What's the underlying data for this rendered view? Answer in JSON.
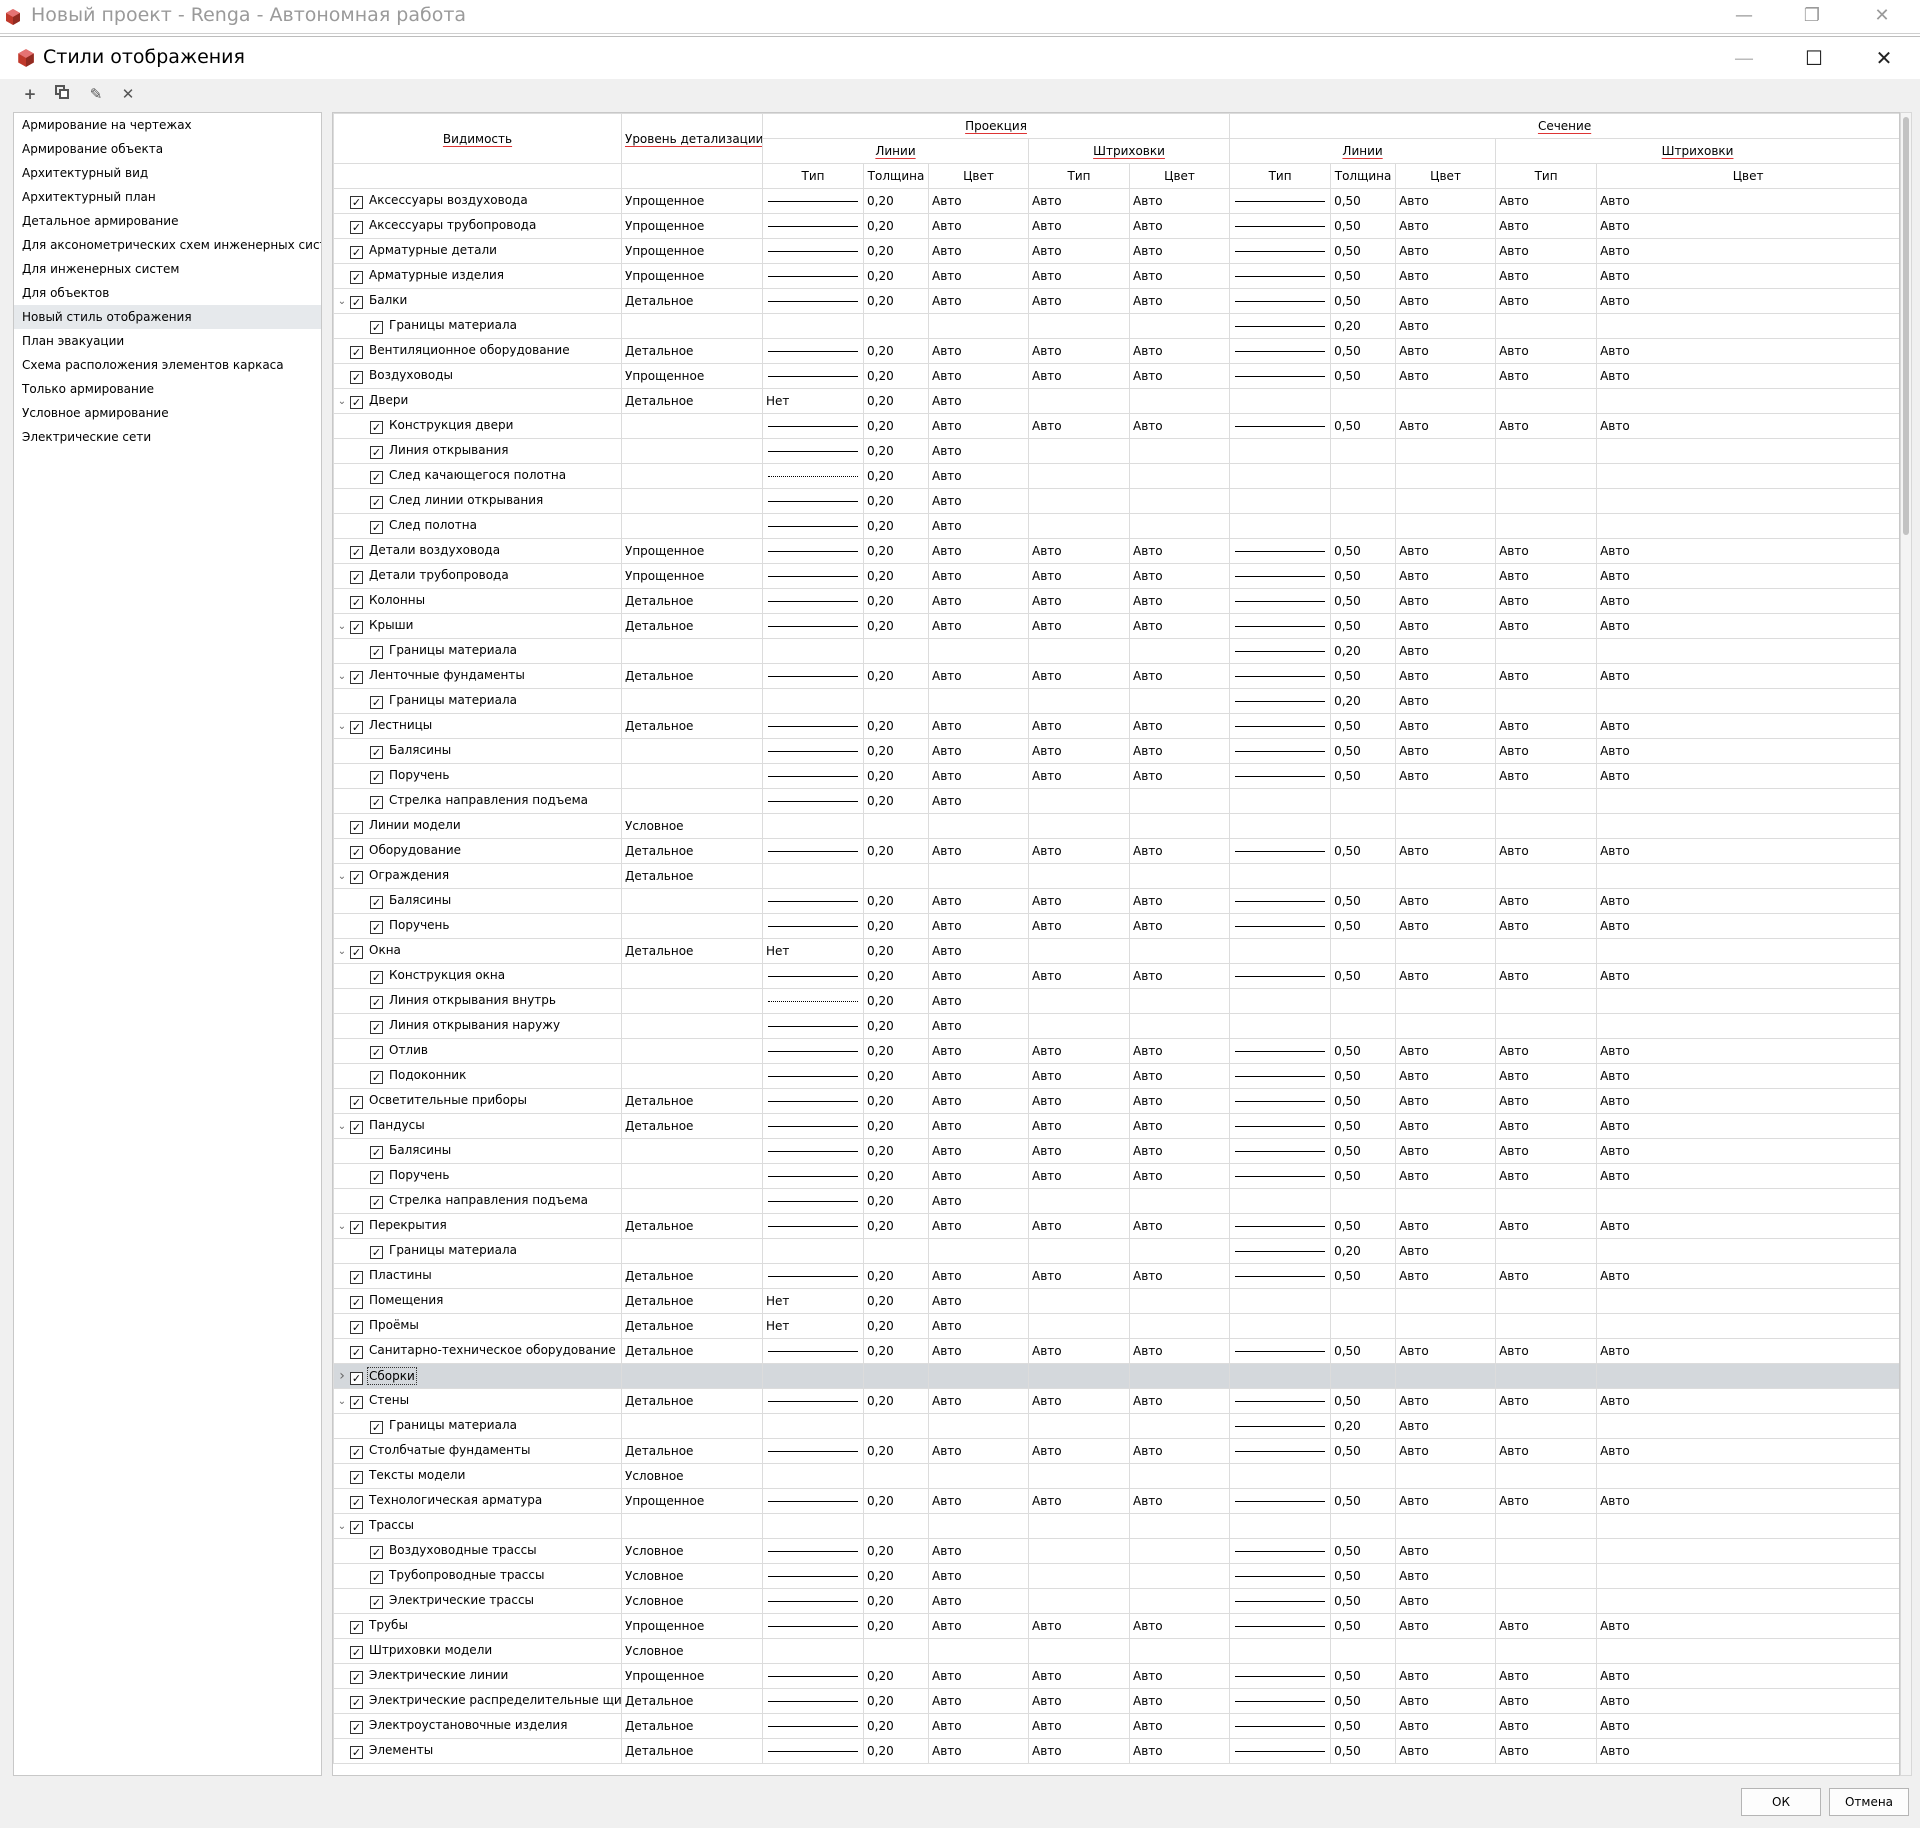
{
  "app": {
    "title": "Новый проект - Renga - Автономная работа"
  },
  "dialog": {
    "title": "Стили отображения"
  },
  "toolbar": {
    "icons": [
      "plus-icon",
      "copy-icon",
      "pencil-icon",
      "delete-icon"
    ]
  },
  "styles": [
    "Армирование на чертежах",
    "Армирование объекта",
    "Архитектурный вид",
    "Архитектурный план",
    "Детальное армирование",
    "Для аксонометрических схем инженерных систем",
    "Для инженерных систем",
    "Для объектов",
    "Новый стиль отображения",
    "План эвакуации",
    "Схема расположения элементов каркаса",
    "Только армирование",
    "Условное армирование",
    "Электрические сети"
  ],
  "selected_style": "Новый стиль отображения",
  "headers": {
    "visibility": "Видимость",
    "detail": "Уровень детализации",
    "projection": "Проекция",
    "section": "Сечение",
    "lines": "Линии",
    "hatch": "Штриховки",
    "type": "Тип",
    "thickness": "Толщина",
    "color": "Цвет"
  },
  "rows": [
    {
      "name": "Аксессуары воздуховода",
      "level": 0,
      "detail": "Упрощенное",
      "pt": "solid",
      "pw": "0,20",
      "pc": "Авто",
      "pht": "Авто",
      "phc": "Авто",
      "st": "solid",
      "sw": "0,50",
      "sc": "Авто",
      "sht": "Авто",
      "shc": "Авто"
    },
    {
      "name": "Аксессуары трубопровода",
      "level": 0,
      "detail": "Упрощенное",
      "pt": "solid",
      "pw": "0,20",
      "pc": "Авто",
      "pht": "Авто",
      "phc": "Авто",
      "st": "solid",
      "sw": "0,50",
      "sc": "Авто",
      "sht": "Авто",
      "shc": "Авто"
    },
    {
      "name": "Арматурные детали",
      "level": 0,
      "detail": "Упрощенное",
      "pt": "solid",
      "pw": "0,20",
      "pc": "Авто",
      "pht": "Авто",
      "phc": "Авто",
      "st": "solid",
      "sw": "0,50",
      "sc": "Авто",
      "sht": "Авто",
      "shc": "Авто"
    },
    {
      "name": "Арматурные изделия",
      "level": 0,
      "detail": "Упрощенное",
      "pt": "solid",
      "pw": "0,20",
      "pc": "Авто",
      "pht": "Авто",
      "phc": "Авто",
      "st": "solid",
      "sw": "0,50",
      "sc": "Авто",
      "sht": "Авто",
      "shc": "Авто"
    },
    {
      "name": "Балки",
      "level": 0,
      "exp": "v",
      "detail": "Детальное",
      "pt": "solid",
      "pw": "0,20",
      "pc": "Авто",
      "pht": "Авто",
      "phc": "Авто",
      "st": "solid",
      "sw": "0,50",
      "sc": "Авто",
      "sht": "Авто",
      "shc": "Авто"
    },
    {
      "name": "Границы материала",
      "level": 1,
      "st": "solid",
      "sw": "0,20",
      "sc": "Авто"
    },
    {
      "name": "Вентиляционное оборудование",
      "level": 0,
      "detail": "Детальное",
      "pt": "solid",
      "pw": "0,20",
      "pc": "Авто",
      "pht": "Авто",
      "phc": "Авто",
      "st": "solid",
      "sw": "0,50",
      "sc": "Авто",
      "sht": "Авто",
      "shc": "Авто"
    },
    {
      "name": "Воздуховоды",
      "level": 0,
      "detail": "Упрощенное",
      "pt": "solid",
      "pw": "0,20",
      "pc": "Авто",
      "pht": "Авто",
      "phc": "Авто",
      "st": "solid",
      "sw": "0,50",
      "sc": "Авто",
      "sht": "Авто",
      "shc": "Авто"
    },
    {
      "name": "Двери",
      "level": 0,
      "exp": "v",
      "detail": "Детальное",
      "pt": "Нет",
      "pw": "0,20",
      "pc": "Авто"
    },
    {
      "name": "Конструкция двери",
      "level": 1,
      "pt": "solid",
      "pw": "0,20",
      "pc": "Авто",
      "pht": "Авто",
      "phc": "Авто",
      "st": "solid",
      "sw": "0,50",
      "sc": "Авто",
      "sht": "Авто",
      "shc": "Авто"
    },
    {
      "name": "Линия открывания",
      "level": 1,
      "pt": "solid",
      "pw": "0,20",
      "pc": "Авто"
    },
    {
      "name": "След качающегося полотна",
      "level": 1,
      "pt": "dotted",
      "pw": "0,20",
      "pc": "Авто"
    },
    {
      "name": "След линии открывания",
      "level": 1,
      "pt": "solid",
      "pw": "0,20",
      "pc": "Авто"
    },
    {
      "name": "След полотна",
      "level": 1,
      "pt": "solid",
      "pw": "0,20",
      "pc": "Авто"
    },
    {
      "name": "Детали воздуховода",
      "level": 0,
      "detail": "Упрощенное",
      "pt": "solid",
      "pw": "0,20",
      "pc": "Авто",
      "pht": "Авто",
      "phc": "Авто",
      "st": "solid",
      "sw": "0,50",
      "sc": "Авто",
      "sht": "Авто",
      "shc": "Авто"
    },
    {
      "name": "Детали трубопровода",
      "level": 0,
      "detail": "Упрощенное",
      "pt": "solid",
      "pw": "0,20",
      "pc": "Авто",
      "pht": "Авто",
      "phc": "Авто",
      "st": "solid",
      "sw": "0,50",
      "sc": "Авто",
      "sht": "Авто",
      "shc": "Авто"
    },
    {
      "name": "Колонны",
      "level": 0,
      "detail": "Детальное",
      "pt": "solid",
      "pw": "0,20",
      "pc": "Авто",
      "pht": "Авто",
      "phc": "Авто",
      "st": "solid",
      "sw": "0,50",
      "sc": "Авто",
      "sht": "Авто",
      "shc": "Авто"
    },
    {
      "name": "Крыши",
      "level": 0,
      "exp": "v",
      "detail": "Детальное",
      "pt": "solid",
      "pw": "0,20",
      "pc": "Авто",
      "pht": "Авто",
      "phc": "Авто",
      "st": "solid",
      "sw": "0,50",
      "sc": "Авто",
      "sht": "Авто",
      "shc": "Авто"
    },
    {
      "name": "Границы материала",
      "level": 1,
      "st": "solid",
      "sw": "0,20",
      "sc": "Авто"
    },
    {
      "name": "Ленточные фундаменты",
      "level": 0,
      "exp": "v",
      "detail": "Детальное",
      "pt": "solid",
      "pw": "0,20",
      "pc": "Авто",
      "pht": "Авто",
      "phc": "Авто",
      "st": "solid",
      "sw": "0,50",
      "sc": "Авто",
      "sht": "Авто",
      "shc": "Авто"
    },
    {
      "name": "Границы материала",
      "level": 1,
      "st": "solid",
      "sw": "0,20",
      "sc": "Авто"
    },
    {
      "name": "Лестницы",
      "level": 0,
      "exp": "v",
      "detail": "Детальное",
      "pt": "solid",
      "pw": "0,20",
      "pc": "Авто",
      "pht": "Авто",
      "phc": "Авто",
      "st": "solid",
      "sw": "0,50",
      "sc": "Авто",
      "sht": "Авто",
      "shc": "Авто"
    },
    {
      "name": "Балясины",
      "level": 1,
      "pt": "solid",
      "pw": "0,20",
      "pc": "Авто",
      "pht": "Авто",
      "phc": "Авто",
      "st": "solid",
      "sw": "0,50",
      "sc": "Авто",
      "sht": "Авто",
      "shc": "Авто"
    },
    {
      "name": "Поручень",
      "level": 1,
      "pt": "solid",
      "pw": "0,20",
      "pc": "Авто",
      "pht": "Авто",
      "phc": "Авто",
      "st": "solid",
      "sw": "0,50",
      "sc": "Авто",
      "sht": "Авто",
      "shc": "Авто"
    },
    {
      "name": "Стрелка направления подъема",
      "level": 1,
      "pt": "solid",
      "pw": "0,20",
      "pc": "Авто"
    },
    {
      "name": "Линии модели",
      "level": 0,
      "detail": "Условное"
    },
    {
      "name": "Оборудование",
      "level": 0,
      "detail": "Детальное",
      "pt": "solid",
      "pw": "0,20",
      "pc": "Авто",
      "pht": "Авто",
      "phc": "Авто",
      "st": "solid",
      "sw": "0,50",
      "sc": "Авто",
      "sht": "Авто",
      "shc": "Авто"
    },
    {
      "name": "Ограждения",
      "level": 0,
      "exp": "v",
      "detail": "Детальное"
    },
    {
      "name": "Балясины",
      "level": 1,
      "pt": "solid",
      "pw": "0,20",
      "pc": "Авто",
      "pht": "Авто",
      "phc": "Авто",
      "st": "solid",
      "sw": "0,50",
      "sc": "Авто",
      "sht": "Авто",
      "shc": "Авто"
    },
    {
      "name": "Поручень",
      "level": 1,
      "pt": "solid",
      "pw": "0,20",
      "pc": "Авто",
      "pht": "Авто",
      "phc": "Авто",
      "st": "solid",
      "sw": "0,50",
      "sc": "Авто",
      "sht": "Авто",
      "shc": "Авто"
    },
    {
      "name": "Окна",
      "level": 0,
      "exp": "v",
      "detail": "Детальное",
      "pt": "Нет",
      "pw": "0,20",
      "pc": "Авто"
    },
    {
      "name": "Конструкция окна",
      "level": 1,
      "pt": "solid",
      "pw": "0,20",
      "pc": "Авто",
      "pht": "Авто",
      "phc": "Авто",
      "st": "solid",
      "sw": "0,50",
      "sc": "Авто",
      "sht": "Авто",
      "shc": "Авто"
    },
    {
      "name": "Линия открывания внутрь",
      "level": 1,
      "pt": "dotted",
      "pw": "0,20",
      "pc": "Авто"
    },
    {
      "name": "Линия открывания наружу",
      "level": 1,
      "pt": "solid",
      "pw": "0,20",
      "pc": "Авто"
    },
    {
      "name": "Отлив",
      "level": 1,
      "pt": "solid",
      "pw": "0,20",
      "pc": "Авто",
      "pht": "Авто",
      "phc": "Авто",
      "st": "solid",
      "sw": "0,50",
      "sc": "Авто",
      "sht": "Авто",
      "shc": "Авто"
    },
    {
      "name": "Подоконник",
      "level": 1,
      "pt": "solid",
      "pw": "0,20",
      "pc": "Авто",
      "pht": "Авто",
      "phc": "Авто",
      "st": "solid",
      "sw": "0,50",
      "sc": "Авто",
      "sht": "Авто",
      "shc": "Авто"
    },
    {
      "name": "Осветительные приборы",
      "level": 0,
      "detail": "Детальное",
      "pt": "solid",
      "pw": "0,20",
      "pc": "Авто",
      "pht": "Авто",
      "phc": "Авто",
      "st": "solid",
      "sw": "0,50",
      "sc": "Авто",
      "sht": "Авто",
      "shc": "Авто"
    },
    {
      "name": "Пандусы",
      "level": 0,
      "exp": "v",
      "detail": "Детальное",
      "pt": "solid",
      "pw": "0,20",
      "pc": "Авто",
      "pht": "Авто",
      "phc": "Авто",
      "st": "solid",
      "sw": "0,50",
      "sc": "Авто",
      "sht": "Авто",
      "shc": "Авто"
    },
    {
      "name": "Балясины",
      "level": 1,
      "pt": "solid",
      "pw": "0,20",
      "pc": "Авто",
      "pht": "Авто",
      "phc": "Авто",
      "st": "solid",
      "sw": "0,50",
      "sc": "Авто",
      "sht": "Авто",
      "shc": "Авто"
    },
    {
      "name": "Поручень",
      "level": 1,
      "pt": "solid",
      "pw": "0,20",
      "pc": "Авто",
      "pht": "Авто",
      "phc": "Авто",
      "st": "solid",
      "sw": "0,50",
      "sc": "Авто",
      "sht": "Авто",
      "shc": "Авто"
    },
    {
      "name": "Стрелка направления подъема",
      "level": 1,
      "pt": "solid",
      "pw": "0,20",
      "pc": "Авто"
    },
    {
      "name": "Перекрытия",
      "level": 0,
      "exp": "v",
      "detail": "Детальное",
      "pt": "solid",
      "pw": "0,20",
      "pc": "Авто",
      "pht": "Авто",
      "phc": "Авто",
      "st": "solid",
      "sw": "0,50",
      "sc": "Авто",
      "sht": "Авто",
      "shc": "Авто"
    },
    {
      "name": "Границы материала",
      "level": 1,
      "st": "solid",
      "sw": "0,20",
      "sc": "Авто"
    },
    {
      "name": "Пластины",
      "level": 0,
      "detail": "Детальное",
      "pt": "solid",
      "pw": "0,20",
      "pc": "Авто",
      "pht": "Авто",
      "phc": "Авто",
      "st": "solid",
      "sw": "0,50",
      "sc": "Авто",
      "sht": "Авто",
      "shc": "Авто"
    },
    {
      "name": "Помещения",
      "level": 0,
      "detail": "Детальное",
      "pt": "Нет",
      "pw": "0,20",
      "pc": "Авто"
    },
    {
      "name": "Проёмы",
      "level": 0,
      "detail": "Детальное",
      "pt": "Нет",
      "pw": "0,20",
      "pc": "Авто"
    },
    {
      "name": "Санитарно-техническое оборудование",
      "level": 0,
      "detail": "Детальное",
      "pt": "solid",
      "pw": "0,20",
      "pc": "Авто",
      "pht": "Авто",
      "phc": "Авто",
      "st": "solid",
      "sw": "0,50",
      "sc": "Авто",
      "sht": "Авто",
      "shc": "Авто"
    },
    {
      "name": "Сборки",
      "level": 0,
      "exp": ">",
      "selected": true
    },
    {
      "name": "Стены",
      "level": 0,
      "exp": "v",
      "detail": "Детальное",
      "pt": "solid",
      "pw": "0,20",
      "pc": "Авто",
      "pht": "Авто",
      "phc": "Авто",
      "st": "solid",
      "sw": "0,50",
      "sc": "Авто",
      "sht": "Авто",
      "shc": "Авто"
    },
    {
      "name": "Границы материала",
      "level": 1,
      "st": "solid",
      "sw": "0,20",
      "sc": "Авто"
    },
    {
      "name": "Столбчатые фундаменты",
      "level": 0,
      "detail": "Детальное",
      "pt": "solid",
      "pw": "0,20",
      "pc": "Авто",
      "pht": "Авто",
      "phc": "Авто",
      "st": "solid",
      "sw": "0,50",
      "sc": "Авто",
      "sht": "Авто",
      "shc": "Авто"
    },
    {
      "name": "Тексты модели",
      "level": 0,
      "detail": "Условное"
    },
    {
      "name": "Технологическая арматура",
      "level": 0,
      "detail": "Упрощенное",
      "pt": "solid",
      "pw": "0,20",
      "pc": "Авто",
      "pht": "Авто",
      "phc": "Авто",
      "st": "solid",
      "sw": "0,50",
      "sc": "Авто",
      "sht": "Авто",
      "shc": "Авто"
    },
    {
      "name": "Трассы",
      "level": 0,
      "exp": "v"
    },
    {
      "name": "Воздуховодные трассы",
      "level": 1,
      "detail": "Условное",
      "pt": "solid",
      "pw": "0,20",
      "pc": "Авто",
      "st": "solid",
      "sw": "0,50",
      "sc": "Авто"
    },
    {
      "name": "Трубопроводные трассы",
      "level": 1,
      "detail": "Условное",
      "pt": "solid",
      "pw": "0,20",
      "pc": "Авто",
      "st": "solid",
      "sw": "0,50",
      "sc": "Авто"
    },
    {
      "name": "Электрические трассы",
      "level": 1,
      "detail": "Условное",
      "pt": "solid",
      "pw": "0,20",
      "pc": "Авто",
      "st": "solid",
      "sw": "0,50",
      "sc": "Авто"
    },
    {
      "name": "Трубы",
      "level": 0,
      "detail": "Упрощенное",
      "pt": "solid",
      "pw": "0,20",
      "pc": "Авто",
      "pht": "Авто",
      "phc": "Авто",
      "st": "solid",
      "sw": "0,50",
      "sc": "Авто",
      "sht": "Авто",
      "shc": "Авто"
    },
    {
      "name": "Штриховки модели",
      "level": 0,
      "detail": "Условное"
    },
    {
      "name": "Электрические линии",
      "level": 0,
      "detail": "Упрощенное",
      "pt": "solid",
      "pw": "0,20",
      "pc": "Авто",
      "pht": "Авто",
      "phc": "Авто",
      "st": "solid",
      "sw": "0,50",
      "sc": "Авто",
      "sht": "Авто",
      "shc": "Авто"
    },
    {
      "name": "Электрические распределительные щиты",
      "level": 0,
      "detail": "Детальное",
      "pt": "solid",
      "pw": "0,20",
      "pc": "Авто",
      "pht": "Авто",
      "phc": "Авто",
      "st": "solid",
      "sw": "0,50",
      "sc": "Авто",
      "sht": "Авто",
      "shc": "Авто"
    },
    {
      "name": "Электроустановочные изделия",
      "level": 0,
      "detail": "Детальное",
      "pt": "solid",
      "pw": "0,20",
      "pc": "Авто",
      "pht": "Авто",
      "phc": "Авто",
      "st": "solid",
      "sw": "0,50",
      "sc": "Авто",
      "sht": "Авто",
      "shc": "Авто"
    },
    {
      "name": "Элементы",
      "level": 0,
      "detail": "Детальное",
      "pt": "solid",
      "pw": "0,20",
      "pc": "Авто",
      "pht": "Авто",
      "phc": "Авто",
      "st": "solid",
      "sw": "0,50",
      "sc": "Авто",
      "sht": "Авто",
      "shc": "Авто"
    }
  ],
  "buttons": {
    "ok": "ОК",
    "cancel": "Отмена"
  },
  "colors": {
    "accent_underline": "#d33333",
    "selected_row": "#d4d8dc",
    "selected_style": "#e6e9ec",
    "logo": "#c0392b"
  }
}
